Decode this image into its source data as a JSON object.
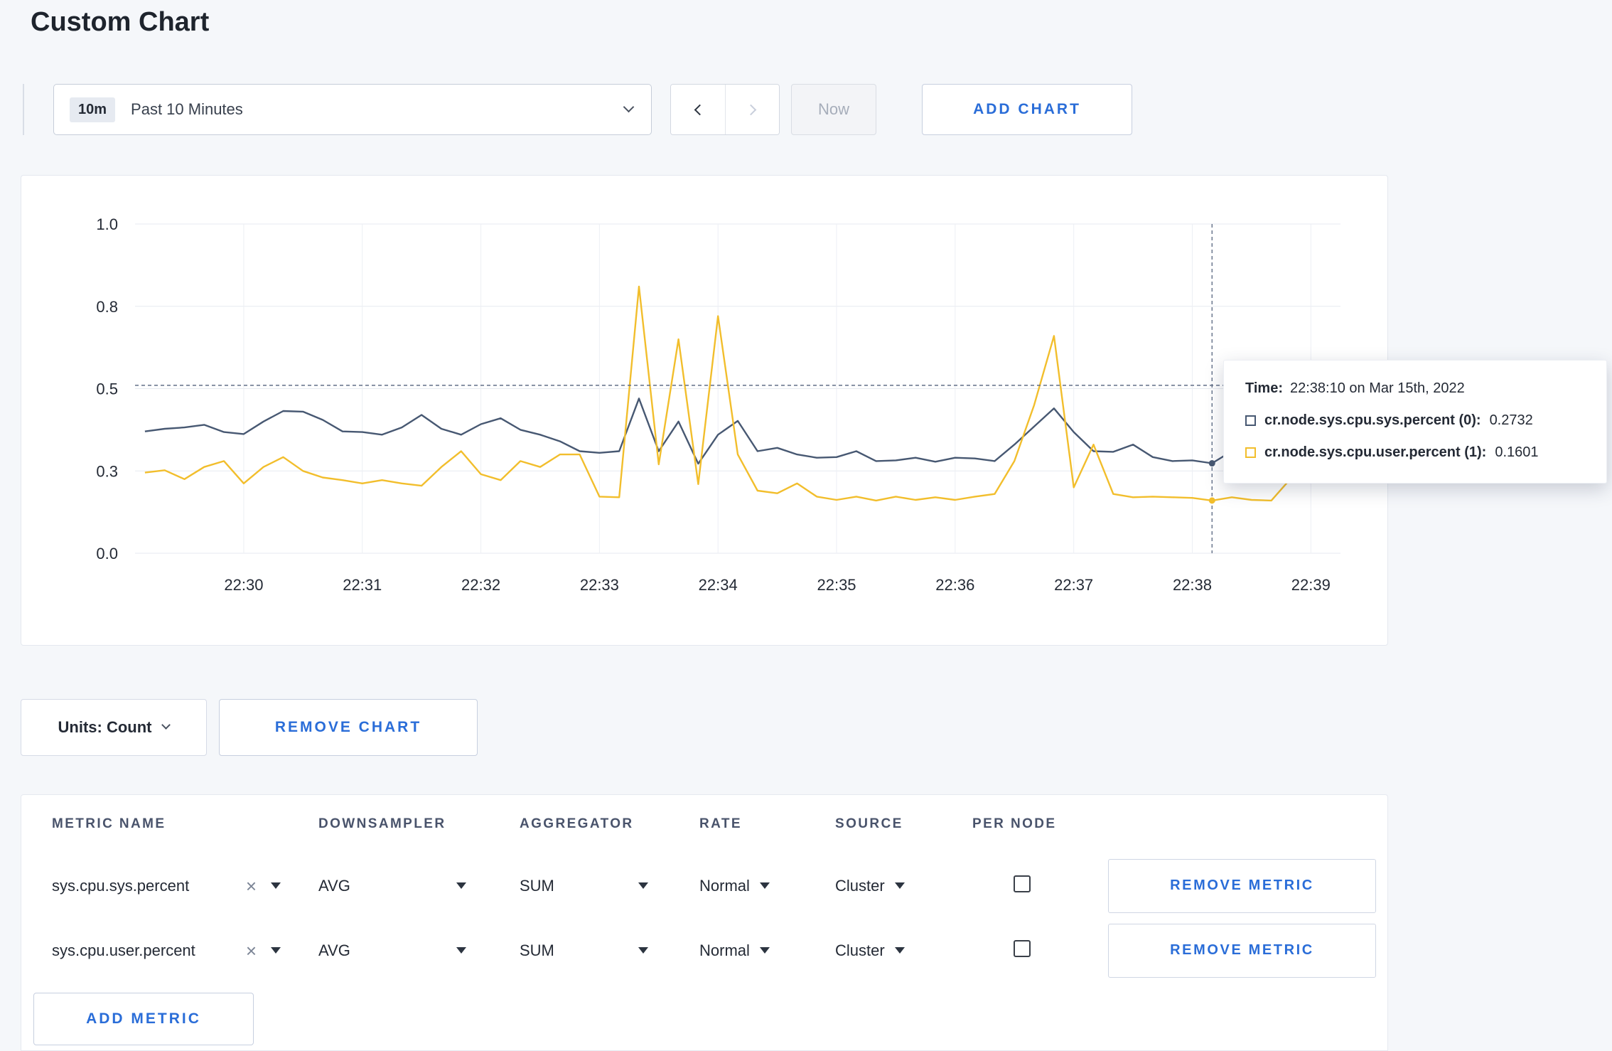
{
  "page": {
    "title": "Custom Chart"
  },
  "toolbar": {
    "time_badge": "10m",
    "time_label": "Past 10 Minutes",
    "now_label": "Now",
    "add_chart_label": "ADD CHART"
  },
  "chart_data": {
    "type": "line",
    "x_tick_labels": [
      "22:30",
      "22:31",
      "22:32",
      "22:33",
      "22:34",
      "22:35",
      "22:36",
      "22:37",
      "22:38",
      "22:39"
    ],
    "y_tick_labels": [
      "1.0",
      "0.8",
      "0.5",
      "0.3",
      "0.0"
    ],
    "ylim": [
      0,
      1.0
    ],
    "grid": true,
    "series": [
      {
        "name": "cr.node.sys.cpu.sys.percent",
        "color": "#475872",
        "values": [
          0.37,
          0.378,
          0.382,
          0.39,
          0.368,
          0.362,
          0.4,
          0.432,
          0.43,
          0.405,
          0.37,
          0.368,
          0.36,
          0.382,
          0.42,
          0.378,
          0.36,
          0.392,
          0.41,
          0.375,
          0.36,
          0.34,
          0.31,
          0.305,
          0.31,
          0.47,
          0.31,
          0.4,
          0.272,
          0.36,
          0.402,
          0.31,
          0.32,
          0.3,
          0.29,
          0.292,
          0.31,
          0.28,
          0.282,
          0.29,
          0.278,
          0.29,
          0.288,
          0.28,
          0.33,
          0.385,
          0.44,
          0.368,
          0.31,
          0.308,
          0.33,
          0.292,
          0.28,
          0.282,
          0.2732,
          0.31,
          0.295,
          0.3,
          0.308,
          0.296,
          0.31
        ]
      },
      {
        "name": "cr.node.sys.cpu.user.percent",
        "color": "#f2be2c",
        "values": [
          0.245,
          0.252,
          0.225,
          0.262,
          0.28,
          0.212,
          0.262,
          0.292,
          0.25,
          0.23,
          0.222,
          0.212,
          0.222,
          0.212,
          0.205,
          0.262,
          0.31,
          0.24,
          0.222,
          0.28,
          0.262,
          0.3,
          0.3,
          0.172,
          0.17,
          0.81,
          0.27,
          0.65,
          0.21,
          0.72,
          0.3,
          0.19,
          0.182,
          0.212,
          0.172,
          0.162,
          0.172,
          0.16,
          0.172,
          0.162,
          0.17,
          0.162,
          0.172,
          0.18,
          0.28,
          0.45,
          0.66,
          0.2,
          0.33,
          0.18,
          0.17,
          0.172,
          0.17,
          0.168,
          0.1601,
          0.17,
          0.162,
          0.16,
          0.228,
          0.278,
          0.24
        ]
      }
    ],
    "crosshair": {
      "index": 54,
      "hline_value": 0.51
    }
  },
  "tooltip": {
    "time_label": "Time:",
    "time_value": "22:38:10 on Mar 15th, 2022",
    "series": [
      {
        "label": "cr.node.sys.cpu.sys.percent (0):",
        "value": "0.2732",
        "color": "#475872"
      },
      {
        "label": "cr.node.sys.cpu.user.percent (1):",
        "value": "0.1601",
        "color": "#f2be2c"
      }
    ]
  },
  "chart_controls": {
    "units_label": "Units: Count",
    "remove_chart_label": "REMOVE CHART"
  },
  "metrics_table": {
    "headers": [
      "METRIC NAME",
      "DOWNSAMPLER",
      "AGGREGATOR",
      "RATE",
      "SOURCE",
      "PER NODE"
    ],
    "rows": [
      {
        "metric": "sys.cpu.sys.percent",
        "downsampler": "AVG",
        "aggregator": "SUM",
        "rate": "Normal",
        "source": "Cluster",
        "per_node": false,
        "remove_label": "REMOVE METRIC"
      },
      {
        "metric": "sys.cpu.user.percent",
        "downsampler": "AVG",
        "aggregator": "SUM",
        "rate": "Normal",
        "source": "Cluster",
        "per_node": false,
        "remove_label": "REMOVE METRIC"
      }
    ],
    "add_metric_label": "ADD METRIC"
  }
}
